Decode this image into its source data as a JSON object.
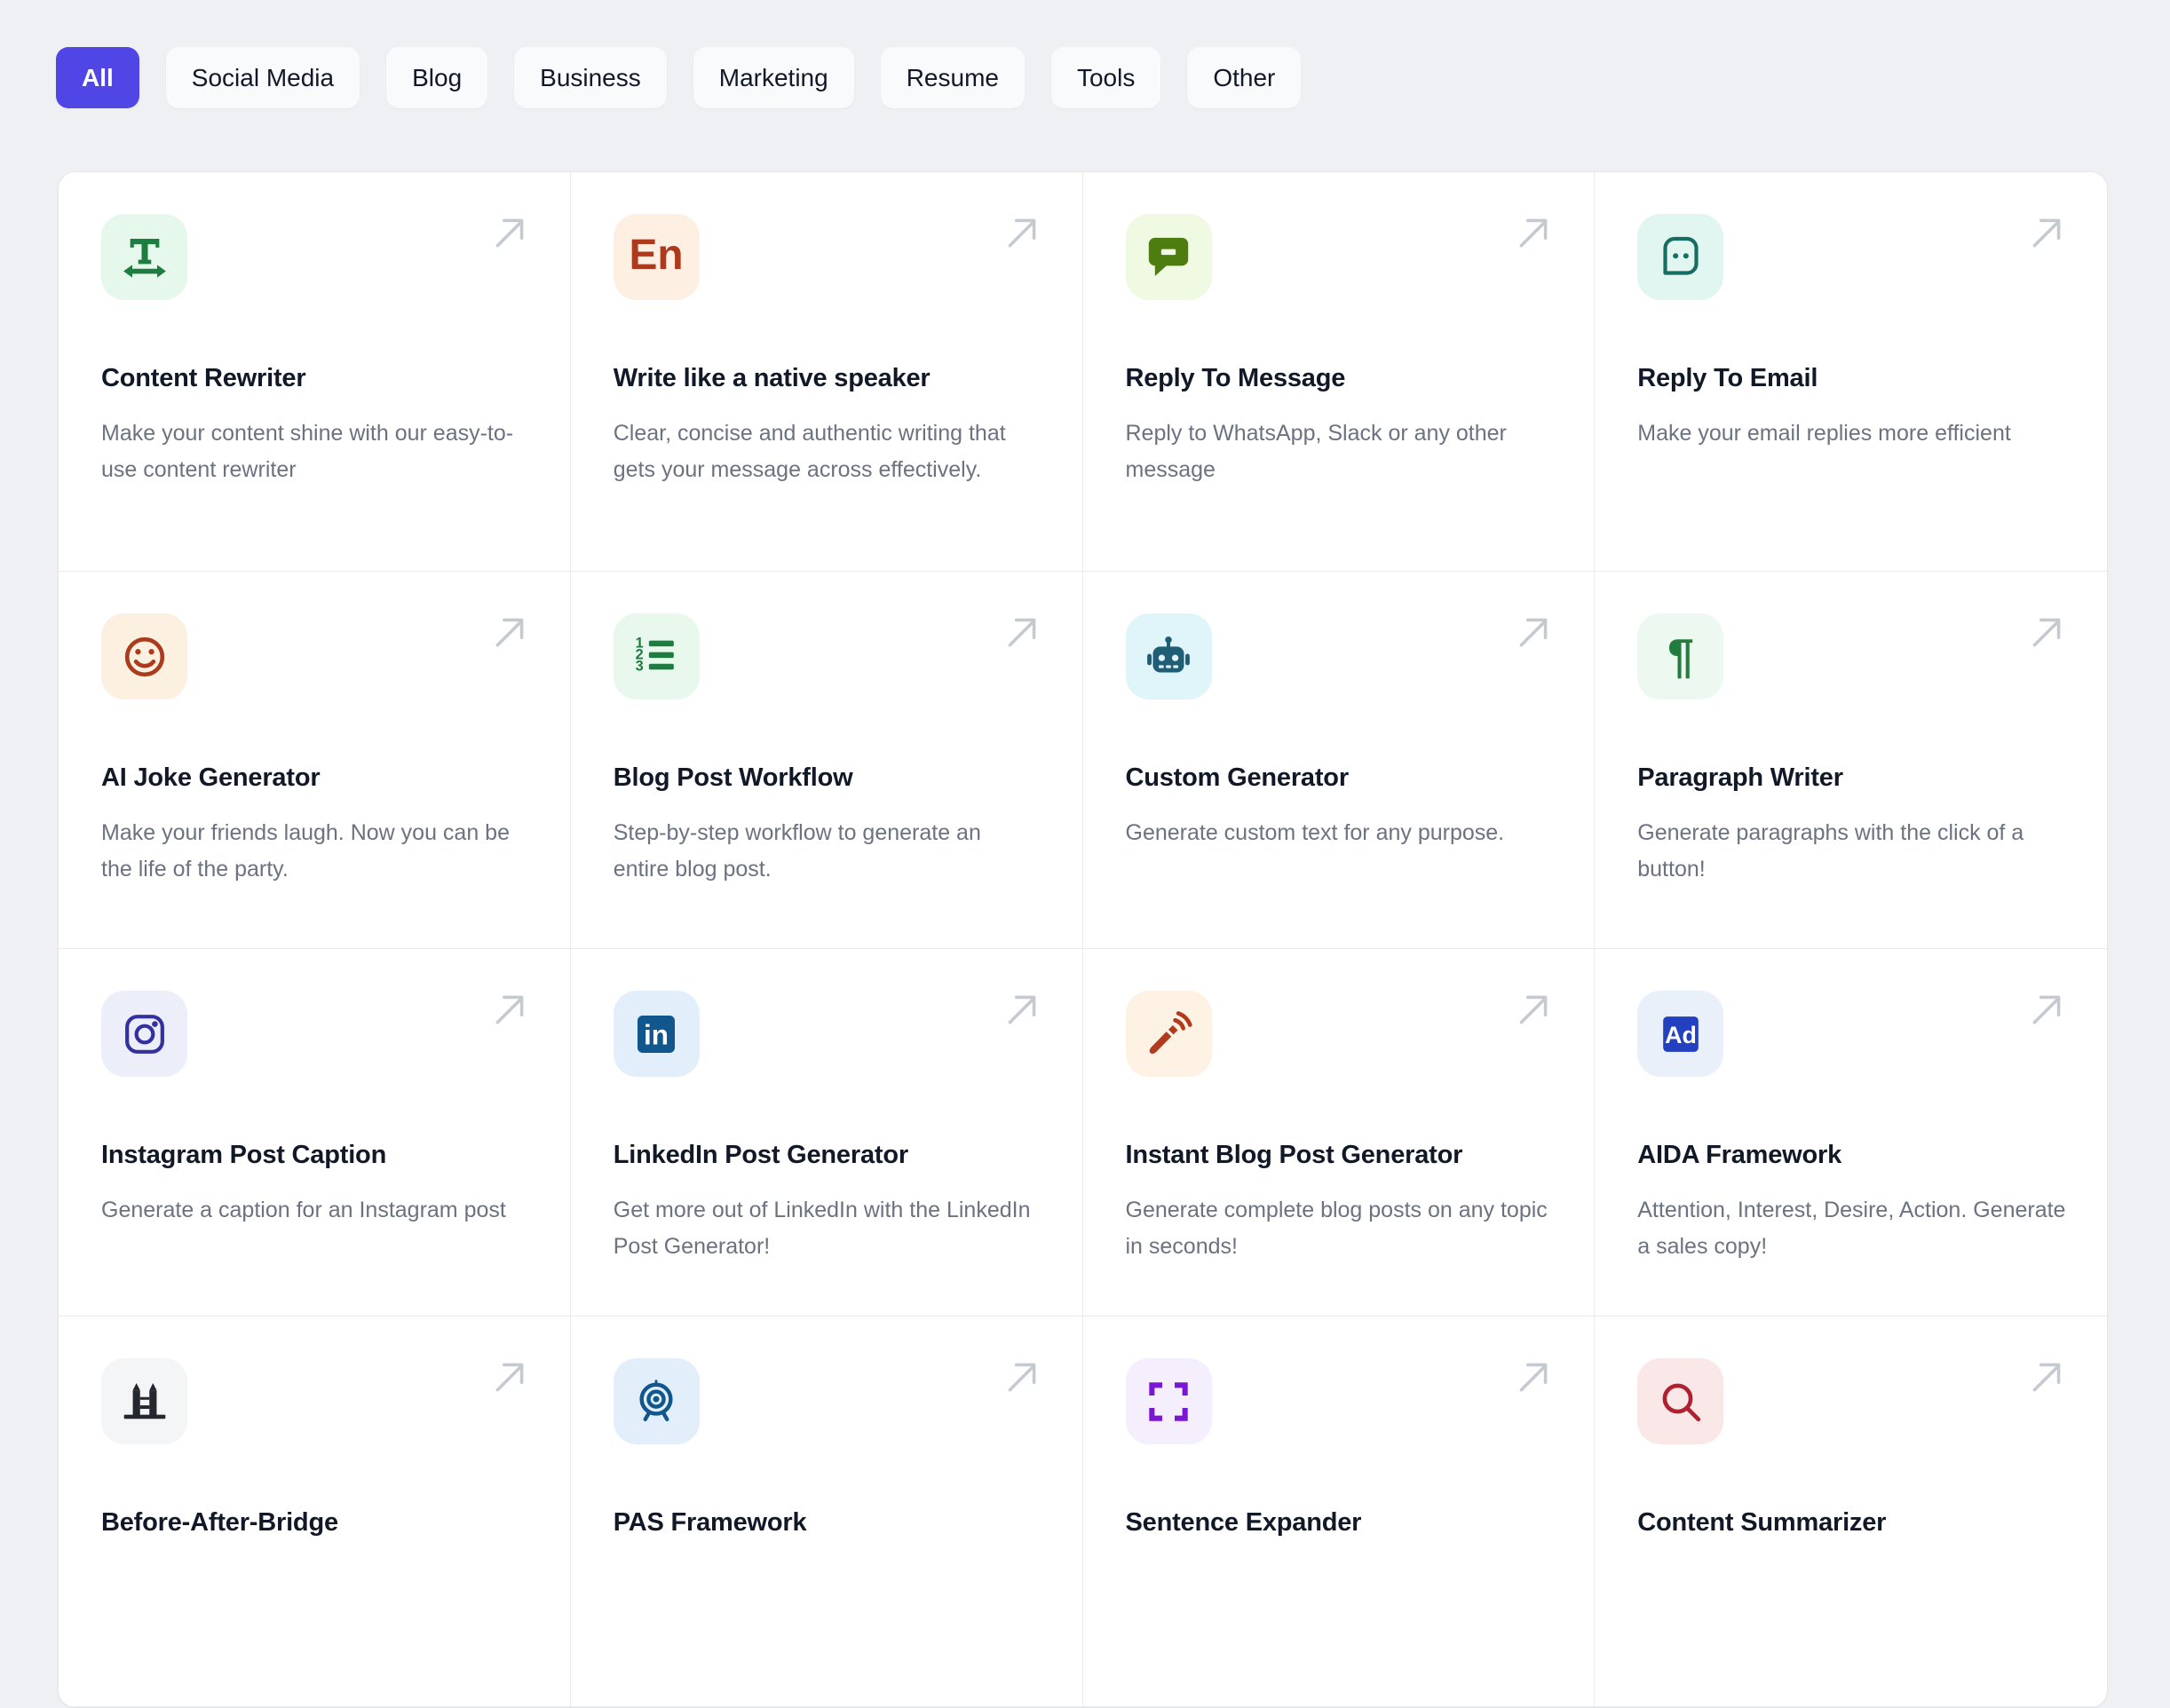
{
  "filters": {
    "items": [
      {
        "label": "All",
        "active": true
      },
      {
        "label": "Social Media",
        "active": false
      },
      {
        "label": "Blog",
        "active": false
      },
      {
        "label": "Business",
        "active": false
      },
      {
        "label": "Marketing",
        "active": false
      },
      {
        "label": "Resume",
        "active": false
      },
      {
        "label": "Tools",
        "active": false
      },
      {
        "label": "Other",
        "active": false
      }
    ],
    "active_color": "#4f46e5",
    "inactive_color": "#f8fafc"
  },
  "grid": {
    "arrow_icon": "arrow-up-right-icon",
    "arrow_color": "#c5c9d0",
    "items": [
      {
        "title": "Content Rewriter",
        "description": "Make your content shine with our easy-to-use content rewriter",
        "icon": "text-width-icon",
        "icon_bg": "#e6f7eb",
        "icon_color": "#1d7c3f"
      },
      {
        "title": "Write like a native speaker",
        "description": "Clear, concise and authentic writing that gets your message across effectively.",
        "icon": "language-en-icon",
        "icon_bg": "#fdf0e2",
        "icon_color": "#ad3a1d"
      },
      {
        "title": "Reply To Message",
        "description": "Reply to WhatsApp, Slack or any other message",
        "icon": "chat-bubble-icon",
        "icon_bg": "#f0f9e1",
        "icon_color": "#4d7c0f"
      },
      {
        "title": "Reply To Email",
        "description": "Make your email replies more efficient",
        "icon": "chat-face-icon",
        "icon_bg": "#e2f6f1",
        "icon_color": "#176d62"
      },
      {
        "title": "AI Joke Generator",
        "description": "Make your friends laugh. Now you can be the life of the party.",
        "icon": "smiley-icon",
        "icon_bg": "#fcf0e0",
        "icon_color": "#ac3b1e"
      },
      {
        "title": "Blog Post Workflow",
        "description": "Step-by-step workflow to generate an entire blog post.",
        "icon": "numbered-list-icon",
        "icon_bg": "#e8f8ec",
        "icon_color": "#1d7c3f"
      },
      {
        "title": "Custom Generator",
        "description": "Generate custom text for any purpose.",
        "icon": "robot-icon",
        "icon_bg": "#dff5fa",
        "icon_color": "#225d76"
      },
      {
        "title": "Paragraph Writer",
        "description": "Generate paragraphs with the click of a button!",
        "icon": "pilcrow-icon",
        "icon_bg": "#edf9f0",
        "icon_color": "#227c3b"
      },
      {
        "title": "Instagram Post Caption",
        "description": "Generate a caption for an Instagram post",
        "icon": "instagram-icon",
        "icon_bg": "#eceefa",
        "icon_color": "#34309e"
      },
      {
        "title": "LinkedIn Post Generator",
        "description": "Get more out of LinkedIn with the LinkedIn Post Generator!",
        "icon": "linkedin-icon",
        "icon_bg": "#e2effa",
        "icon_color": "#11568c"
      },
      {
        "title": "Instant Blog Post Generator",
        "description": "Generate complete blog posts on any topic in seconds!",
        "icon": "pen-signal-icon",
        "icon_bg": "#fdf2e3",
        "icon_color": "#b03b1d"
      },
      {
        "title": "AIDA Framework",
        "description": "Attention, Interest, Desire, Action. Generate a sales copy!",
        "icon": "ad-badge-icon",
        "icon_bg": "#eaf0fa",
        "icon_color": "#2340c0"
      },
      {
        "title": "Before-After-Bridge",
        "description": "",
        "icon": "bridge-icon",
        "icon_bg": "#f4f5f6",
        "icon_color": "#23272e"
      },
      {
        "title": "PAS Framework",
        "description": "",
        "icon": "target-icon",
        "icon_bg": "#e2effa",
        "icon_color": "#11568c"
      },
      {
        "title": "Sentence Expander",
        "description": "",
        "icon": "expand-icon",
        "icon_bg": "#f5effd",
        "icon_color": "#7b16d3"
      },
      {
        "title": "Content Summarizer",
        "description": "",
        "icon": "magnifier-icon",
        "icon_bg": "#fae8e8",
        "icon_color": "#b02030"
      }
    ]
  }
}
